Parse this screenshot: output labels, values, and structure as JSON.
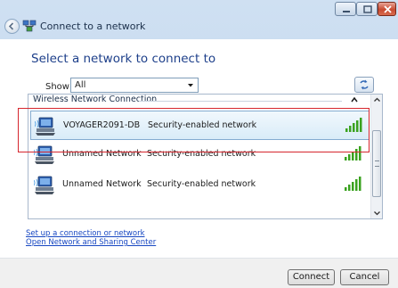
{
  "window": {
    "title": "Connect to a network",
    "icons": [
      "back-icon",
      "network-icon",
      "minimize-icon",
      "maximize-icon",
      "close-icon"
    ]
  },
  "main": {
    "heading": "Select a network to connect to",
    "show_label": "Show",
    "show_value": "All"
  },
  "list": {
    "group_header": "Wireless Network Connection",
    "networks": [
      {
        "ssid": "VOYAGER2091-DB",
        "security": "Security-enabled network",
        "selected": true,
        "signal_bars": 5
      },
      {
        "ssid": "Unnamed Network",
        "security": "Security-enabled network",
        "selected": false,
        "signal_bars": 5
      },
      {
        "ssid": "Unnamed Network",
        "security": "Security-enabled network",
        "selected": false,
        "signal_bars": 5
      }
    ]
  },
  "links": {
    "setup": "Set up a connection or network",
    "sharing_center": "Open Network and Sharing Center"
  },
  "footer": {
    "connect_label": "Connect",
    "cancel_label": "Cancel"
  },
  "colors": {
    "heading": "#1d3f8a",
    "link": "#1747c2",
    "highlight": "#d6262e",
    "signal": "#3aa21f"
  }
}
